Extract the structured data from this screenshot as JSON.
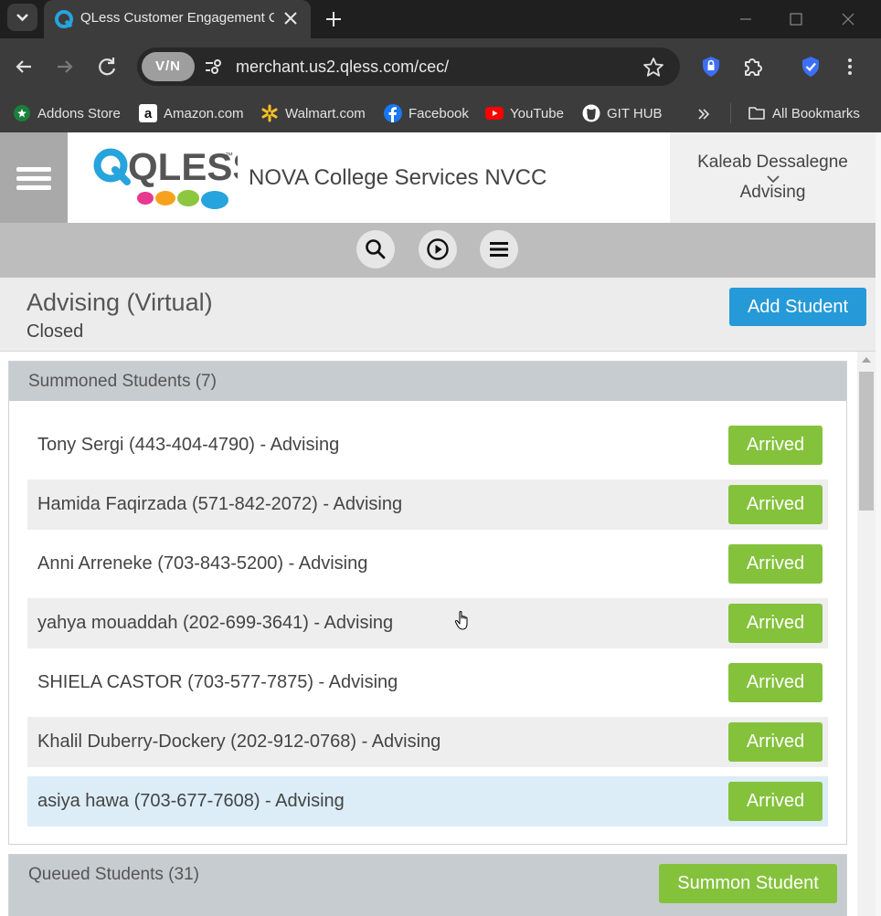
{
  "browser": {
    "tab_title": "QLess Customer Engagement C",
    "url": "merchant.us2.qless.com/cec/",
    "vpn_label": "V/N",
    "bookmarks": [
      {
        "label": "Addons Store",
        "icon": "addons-icon"
      },
      {
        "label": "Amazon.com",
        "icon": "amazon-icon"
      },
      {
        "label": "Walmart.com",
        "icon": "walmart-icon"
      },
      {
        "label": "Facebook",
        "icon": "facebook-icon"
      },
      {
        "label": "YouTube",
        "icon": "youtube-icon"
      },
      {
        "label": "GIT HUB",
        "icon": "github-icon"
      }
    ],
    "all_bookmarks": "All Bookmarks"
  },
  "header": {
    "logo_text": "QLESS",
    "logo_tm": "™",
    "org_name": "NOVA College Services NVCC",
    "user_name": "Kaleab Dessalegne",
    "user_role": "Advising"
  },
  "queue": {
    "title": "Advising (Virtual)",
    "status": "Closed",
    "add_button": "Add Student"
  },
  "summoned": {
    "title": "Summoned Students (7)",
    "action_label": "Arrived",
    "rows": [
      "Tony Sergi (443-404-4790) - Advising",
      "Hamida Faqirzada (571-842-2072) - Advising",
      "Anni Arreneke (703-843-5200) - Advising",
      "yahya mouaddah (202-699-3641) - Advising",
      "SHIELA CASTOR (703-577-7875) - Advising",
      "Khalil Duberry-Dockery (202-912-0768) - Advising",
      "asiya hawa (703-677-7608) - Advising"
    ]
  },
  "queued": {
    "title": "Queued Students (31)",
    "summon_button": "Summon Student"
  },
  "colors": {
    "accent_blue": "#269ad8",
    "arrived_green": "#84c23c",
    "highlight_row": "#dcedf7"
  }
}
